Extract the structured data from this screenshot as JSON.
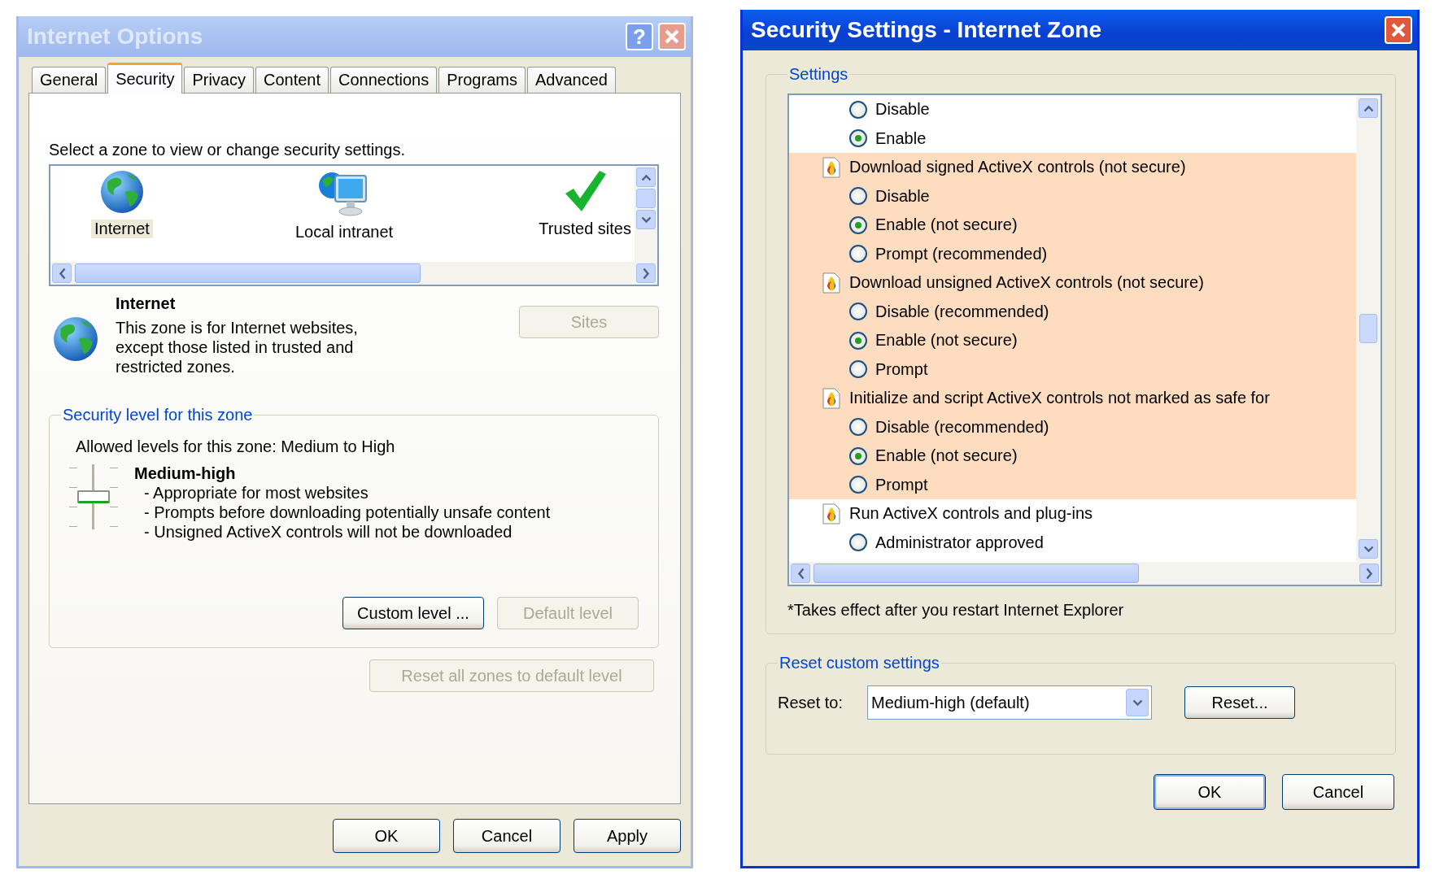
{
  "options_window": {
    "title": "Internet Options",
    "active": false,
    "help": "?",
    "tabs": [
      {
        "label": "General",
        "selected": false
      },
      {
        "label": "Security",
        "selected": true
      },
      {
        "label": "Privacy",
        "selected": false
      },
      {
        "label": "Content",
        "selected": false
      },
      {
        "label": "Connections",
        "selected": false
      },
      {
        "label": "Programs",
        "selected": false
      },
      {
        "label": "Advanced",
        "selected": false
      }
    ],
    "zone_prompt": "Select a zone to view or change security settings.",
    "zones": [
      {
        "label": "Internet",
        "kind": "globe",
        "selected": true
      },
      {
        "label": "Local intranet",
        "kind": "intranet",
        "selected": false
      },
      {
        "label": "Trusted sites",
        "kind": "check",
        "selected": false
      }
    ],
    "zone_detail": {
      "title": "Internet",
      "description": "This zone is for Internet websites, except those listed in trusted and restricted zones.",
      "sites_button": {
        "label": "Sites",
        "disabled": true
      }
    },
    "security_level": {
      "legend": "Security level for this zone",
      "allowed": "Allowed levels for this zone: Medium to High",
      "level_name": "Medium-high",
      "level": 0.5,
      "bullets": [
        "- Appropriate for most websites",
        "- Prompts before downloading potentially unsafe content",
        "- Unsigned ActiveX controls will not be downloaded"
      ],
      "buttons": [
        {
          "label": "Custom level ...",
          "disabled": false
        },
        {
          "label": "Default level",
          "disabled": true
        }
      ]
    },
    "reset_all_button": {
      "label": "Reset all zones to default level",
      "disabled": true
    },
    "buttons": [
      {
        "label": "OK",
        "disabled": false
      },
      {
        "label": "Cancel",
        "disabled": false
      },
      {
        "label": "Apply",
        "disabled": false
      }
    ]
  },
  "settings_window": {
    "title": "Security Settings - Internet Zone",
    "active": true,
    "settings": {
      "legend": "Settings",
      "rows": [
        {
          "kind": "option",
          "label": "Disable",
          "selected": false,
          "highlighted": false
        },
        {
          "kind": "option",
          "label": "Enable",
          "selected": true,
          "highlighted": false
        },
        {
          "kind": "heading",
          "label": "Download signed ActiveX controls (not secure)",
          "highlighted": true
        },
        {
          "kind": "option",
          "label": "Disable",
          "selected": false,
          "highlighted": true
        },
        {
          "kind": "option",
          "label": "Enable (not secure)",
          "selected": true,
          "highlighted": true
        },
        {
          "kind": "option",
          "label": "Prompt (recommended)",
          "selected": false,
          "highlighted": true
        },
        {
          "kind": "heading",
          "label": "Download unsigned ActiveX controls (not secure)",
          "highlighted": true
        },
        {
          "kind": "option",
          "label": "Disable (recommended)",
          "selected": false,
          "highlighted": true
        },
        {
          "kind": "option",
          "label": "Enable (not secure)",
          "selected": true,
          "highlighted": true
        },
        {
          "kind": "option",
          "label": "Prompt",
          "selected": false,
          "highlighted": true
        },
        {
          "kind": "heading",
          "label": "Initialize and script ActiveX controls not marked as safe for",
          "highlighted": true
        },
        {
          "kind": "option",
          "label": "Disable (recommended)",
          "selected": false,
          "highlighted": true
        },
        {
          "kind": "option",
          "label": "Enable (not secure)",
          "selected": true,
          "highlighted": true
        },
        {
          "kind": "option",
          "label": "Prompt",
          "selected": false,
          "highlighted": true
        },
        {
          "kind": "heading",
          "label": "Run ActiveX controls and plug-ins",
          "highlighted": false
        },
        {
          "kind": "option",
          "label": "Administrator approved",
          "selected": false,
          "highlighted": false
        }
      ],
      "note": "*Takes effect after you restart Internet Explorer"
    },
    "reset": {
      "legend": "Reset custom settings",
      "label": "Reset to:",
      "value": "Medium-high (default)",
      "button": {
        "label": "Reset...",
        "disabled": false
      }
    },
    "buttons": [
      {
        "label": "OK",
        "disabled": false,
        "default": true
      },
      {
        "label": "Cancel",
        "disabled": false,
        "default": false
      }
    ]
  }
}
